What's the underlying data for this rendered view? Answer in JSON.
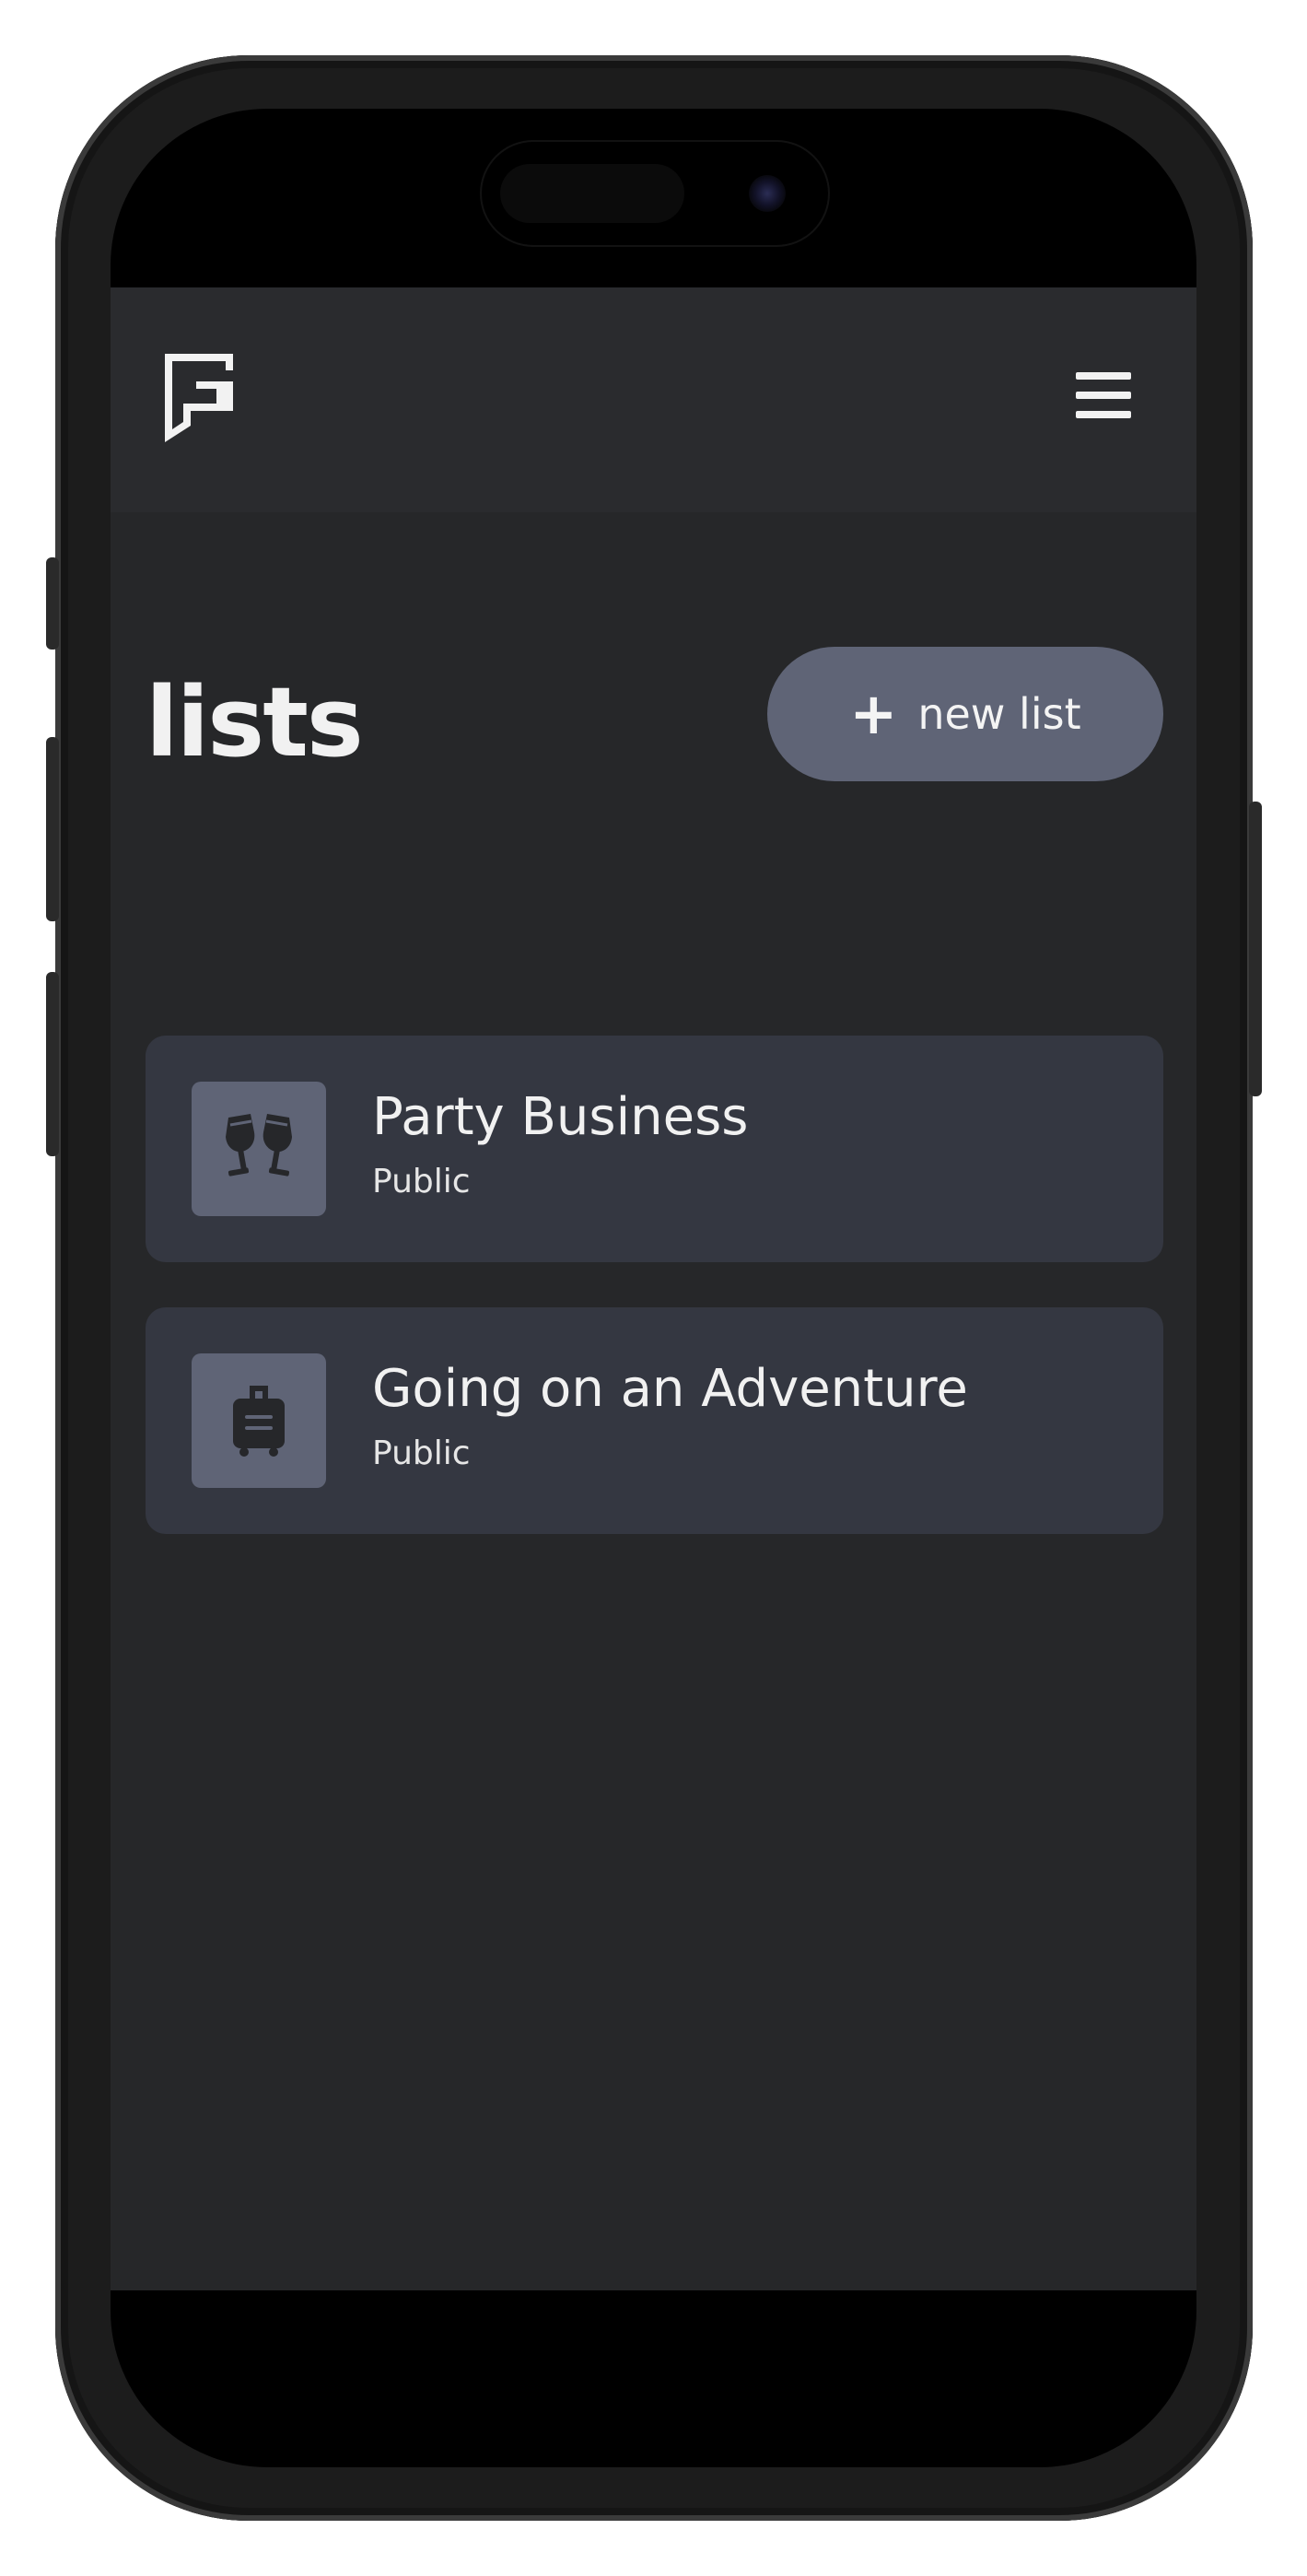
{
  "header": {
    "logo_icon": "logo-icon",
    "menu_icon": "hamburger-menu-icon"
  },
  "main": {
    "title": "lists",
    "new_list_button": {
      "icon": "plus-icon",
      "icon_glyph": "+",
      "label": "new list"
    },
    "lists": [
      {
        "title": "Party Business",
        "visibility": "Public",
        "icon": "champagne-glasses-icon"
      },
      {
        "title": "Going on an Adventure",
        "visibility": "Public",
        "icon": "suitcase-icon"
      }
    ]
  },
  "colors": {
    "background": "#262729",
    "header_background": "#2a2b2e",
    "card_background": "#343741",
    "accent": "#5f6476",
    "text": "#f1f1f1"
  }
}
